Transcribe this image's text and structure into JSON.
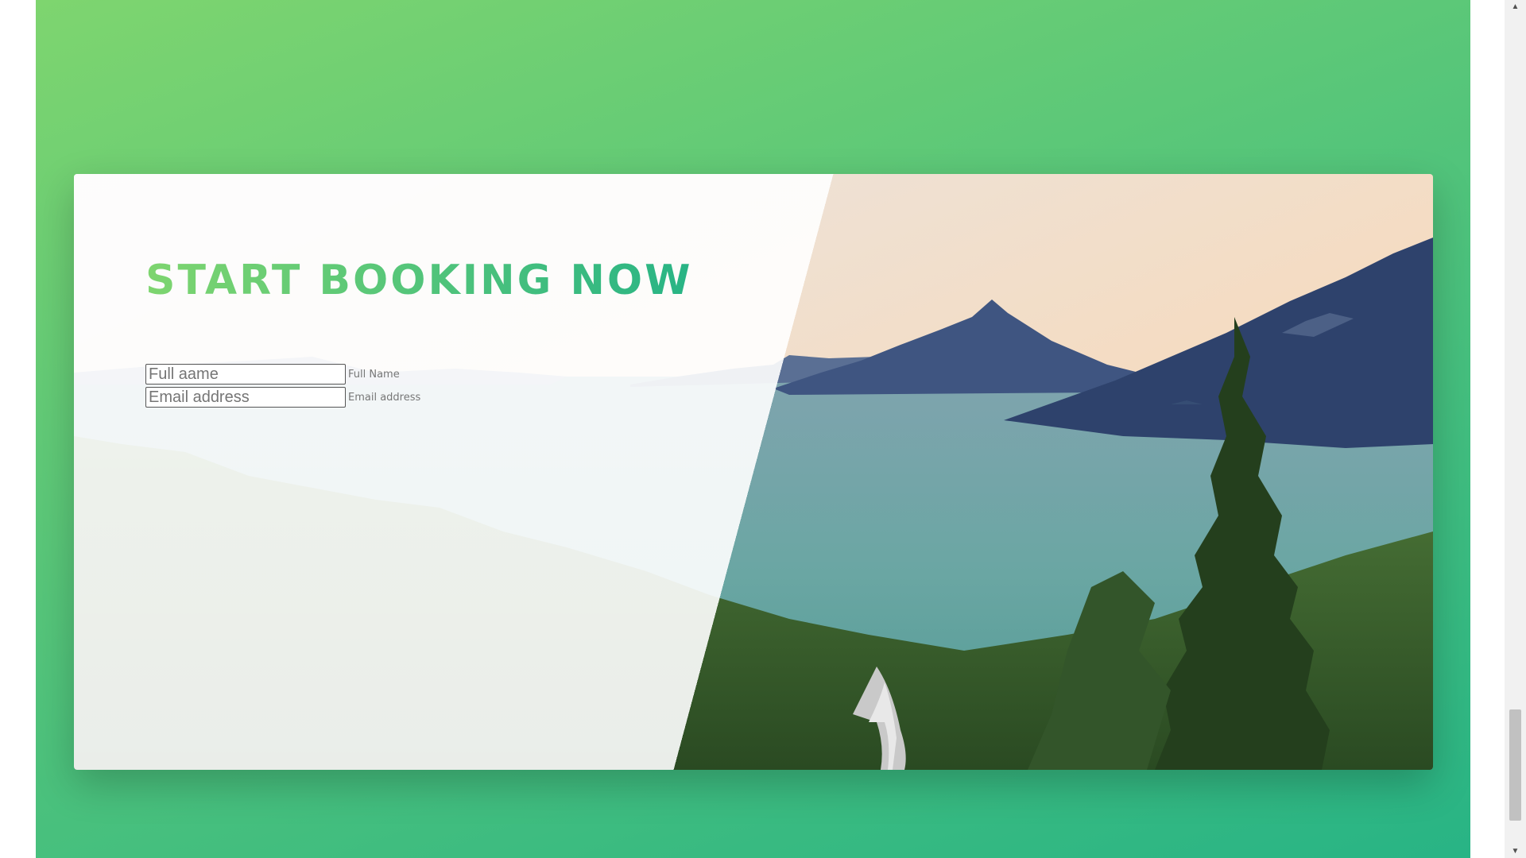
{
  "booking": {
    "title": "START BOOKING NOW",
    "name_field": {
      "placeholder": "Full aame",
      "label": "Full Name"
    },
    "email_field": {
      "placeholder": "Email address",
      "label": "Email address"
    }
  },
  "colors": {
    "gradient_light": "#7ed56f",
    "gradient_mid": "#55c57a",
    "gradient_dark": "#28b485"
  },
  "scrollbar": {
    "up_icon": "triangle-up",
    "down_icon": "triangle-down"
  }
}
